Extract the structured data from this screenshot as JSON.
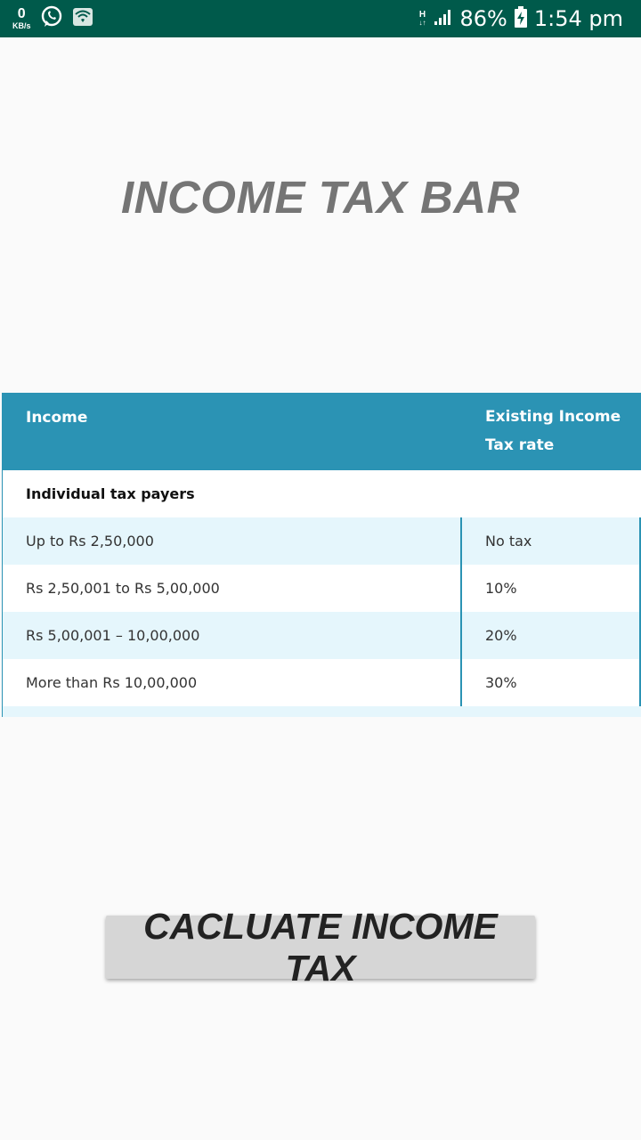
{
  "status_bar": {
    "speed_value": "0",
    "speed_unit": "KB/s",
    "network_type": "H",
    "battery_percent": "86%",
    "time": "1:54 pm",
    "icons": [
      "whatsapp-icon",
      "wifi-box-icon",
      "signal-icon",
      "battery-charging-icon"
    ]
  },
  "title": "INCOME TAX BAR",
  "table": {
    "header_income": "Income",
    "header_rate": "Existing Income Tax rate",
    "group_label": "Individual tax payers",
    "rows": [
      {
        "income": "Up to Rs 2,50,000",
        "rate": "No tax"
      },
      {
        "income": "Rs 2,50,001 to Rs 5,00,000",
        "rate": "10%"
      },
      {
        "income": "Rs 5,00,001 – 10,00,000",
        "rate": "20%"
      },
      {
        "income": "More than Rs 10,00,000",
        "rate": "30%"
      }
    ],
    "colors": {
      "header": "#2b93b4",
      "alt_row": "#e5f6fc"
    }
  },
  "button": {
    "label": "CACLUATE INCOME TAX"
  }
}
